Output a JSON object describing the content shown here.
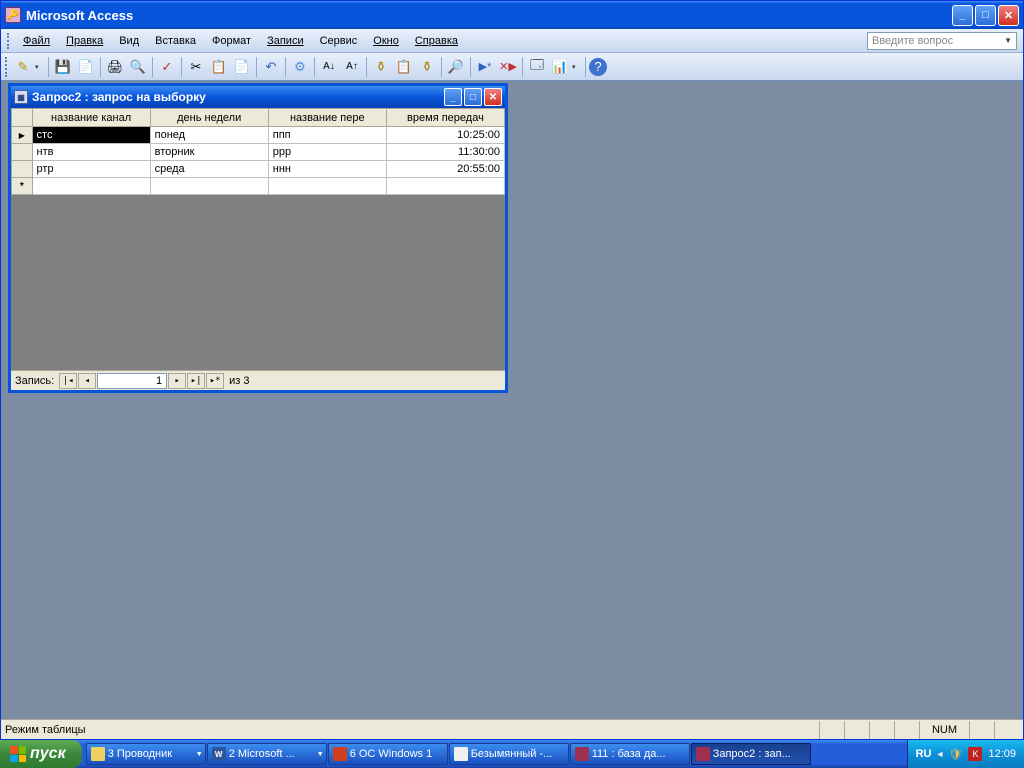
{
  "app": {
    "title": "Microsoft Access"
  },
  "menus": {
    "file": "Файл",
    "edit": "Правка",
    "view": "Вид",
    "insert": "Вставка",
    "format": "Формат",
    "records": "Записи",
    "service": "Сервис",
    "window": "Окно",
    "help": "Справка"
  },
  "question_box": {
    "placeholder": "Введите вопрос"
  },
  "child_window": {
    "title": "Запрос2 : запрос на выборку"
  },
  "grid": {
    "columns": [
      "название канал",
      "день недели",
      "название пере",
      "время передач"
    ],
    "rows": [
      {
        "channel": "стс",
        "day": "понед",
        "show": "ппп",
        "time": "10:25:00"
      },
      {
        "channel": "нтв",
        "day": "вторник",
        "show": "ррр",
        "time": "11:30:00"
      },
      {
        "channel": "ртр",
        "day": "среда",
        "show": "ннн",
        "time": "20:55:00"
      }
    ]
  },
  "record_nav": {
    "label": "Запись:",
    "current": "1",
    "total_label": "из  3"
  },
  "status": {
    "mode": "Режим таблицы",
    "num": "NUM"
  },
  "taskbar": {
    "start": "пуск",
    "items": [
      {
        "label": "3 Проводник",
        "icon": "folder",
        "group": true
      },
      {
        "label": "2 Microsoft ...",
        "icon": "word",
        "group": true
      },
      {
        "label": "6 OC Windows 1",
        "icon": "ppt",
        "group": false
      },
      {
        "label": "Безымянный -...",
        "icon": "paint",
        "group": false
      },
      {
        "label": "111 : база да...",
        "icon": "access",
        "group": false
      },
      {
        "label": "Запрос2 : зап...",
        "icon": "access",
        "group": false,
        "active": true
      }
    ],
    "lang": "RU",
    "clock": "12:09"
  }
}
